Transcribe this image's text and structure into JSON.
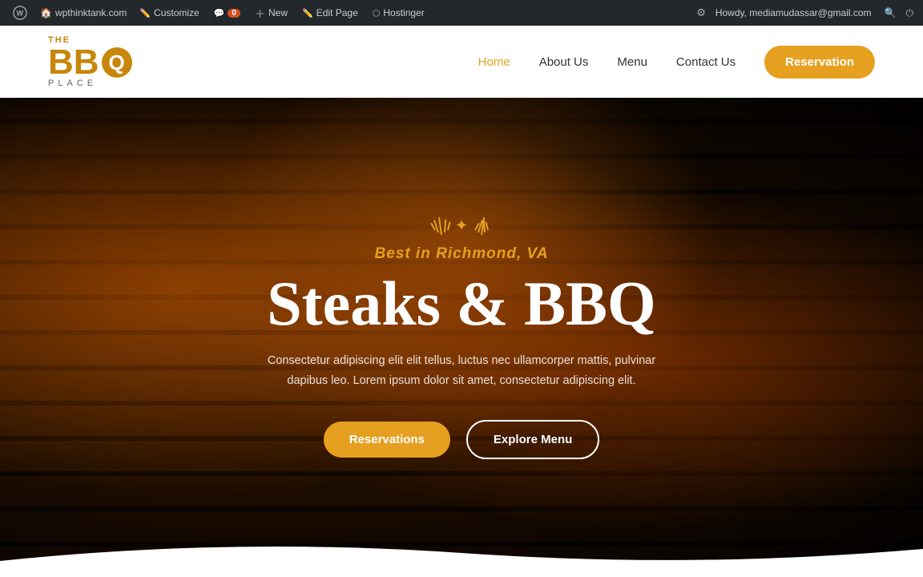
{
  "admin_bar": {
    "wp_icon": "W",
    "site_name": "wpthinktank.com",
    "customize": "Customize",
    "comments": "0",
    "new": "New",
    "edit_page": "Edit Page",
    "hostinger": "Hostinger",
    "howdy": "Howdy, mediamudassar@gmail.com",
    "screen_options": "⚙"
  },
  "nav": {
    "logo_the": "THE",
    "logo_bbq": "BBQ",
    "logo_place": "PLACE",
    "links": [
      {
        "label": "Home",
        "active": true
      },
      {
        "label": "About Us",
        "active": false
      },
      {
        "label": "Menu",
        "active": false
      },
      {
        "label": "Contact Us",
        "active": false
      }
    ],
    "cta": "Reservation"
  },
  "hero": {
    "subtitle": "Best in Richmond, VA",
    "title": "Steaks & BBQ",
    "description": "Consectetur adipiscing elit elit tellus, luctus nec ullamcorper mattis, pulvinar dapibus leo. Lorem ipsum dolor sit amet, consectetur adipiscing elit.",
    "btn_reservations": "Reservations",
    "btn_explore": "Explore Menu"
  }
}
